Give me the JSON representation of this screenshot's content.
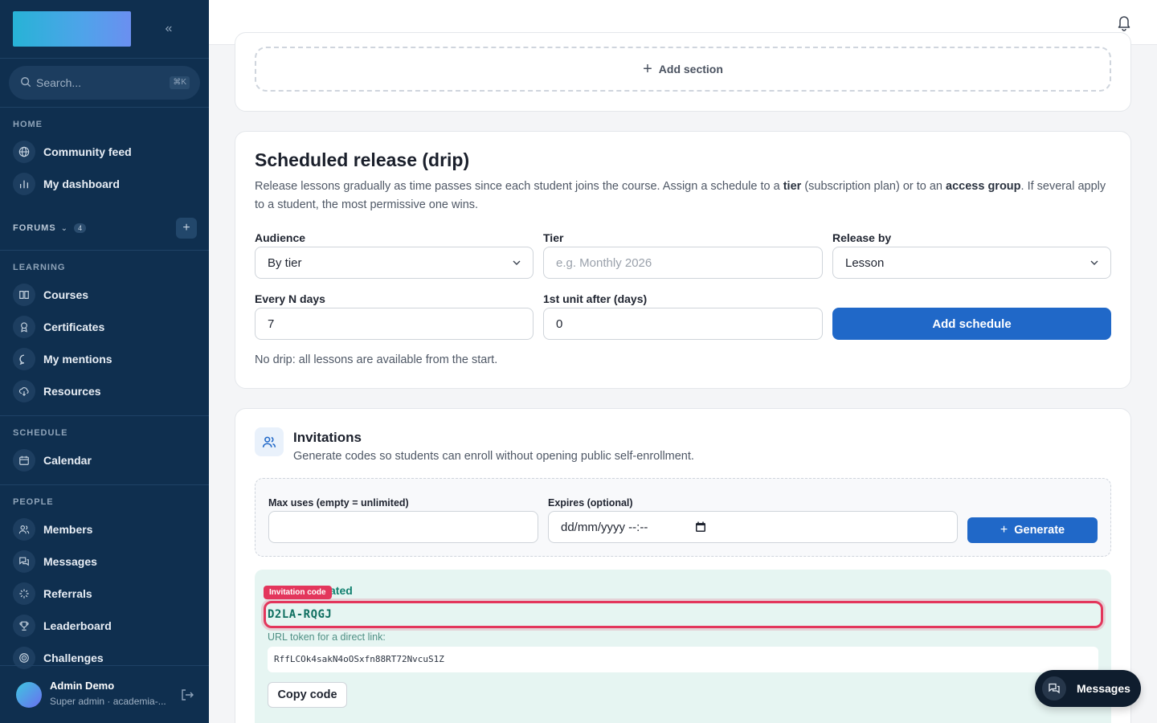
{
  "sidebar": {
    "collapse_icon": "double-chevron-left-icon",
    "search": {
      "placeholder": "Search...",
      "shortcut": "⌘K"
    },
    "sections": {
      "home": "HOME",
      "forums": "FORUMS",
      "forums_count": "4",
      "learning": "LEARNING",
      "schedule": "SCHEDULE",
      "people": "PEOPLE"
    },
    "items": {
      "community_feed": "Community feed",
      "my_dashboard": "My dashboard",
      "courses": "Courses",
      "certificates": "Certificates",
      "my_mentions": "My mentions",
      "resources": "Resources",
      "calendar": "Calendar",
      "members": "Members",
      "messages": "Messages",
      "referrals": "Referrals",
      "leaderboard": "Leaderboard",
      "challenges": "Challenges"
    },
    "user": {
      "name": "Admin Demo",
      "role": "Super admin · academia-..."
    }
  },
  "main": {
    "add_section": "Add section",
    "drip": {
      "title": "Scheduled release (drip)",
      "desc_1": "Release lessons gradually as time passes since each student joins the course. Assign a schedule to a ",
      "desc_tier": "tier",
      "desc_2": " (subscription plan) or to an ",
      "desc_group": "access group",
      "desc_3": ". If several apply to a student, the most permissive one wins.",
      "audience_label": "Audience",
      "audience_value": "By tier",
      "tier_label": "Tier",
      "tier_placeholder": "e.g. Monthly 2026",
      "release_label": "Release by",
      "release_value": "Lesson",
      "every_label": "Every N days",
      "every_value": "7",
      "first_label": "1st unit after (days)",
      "first_value": "0",
      "add_button": "Add schedule",
      "status": "No drip: all lessons are available from the start."
    },
    "invitations": {
      "title": "Invitations",
      "desc": "Generate codes so students can enroll without opening public self-enrollment.",
      "max_label": "Max uses (empty = unlimited)",
      "max_value": "",
      "expires_label": "Expires (optional)",
      "expires_value": "dd/mm/yyyy --:--",
      "generate_button": "Generate",
      "generated_label": "Code generated",
      "badge": "Invitation code",
      "code": "D2LA-RQGJ",
      "url_label": "URL token for a direct link:",
      "url_token": "RffLCOk4sakN4oOSxfn88RT72NvcuS1Z",
      "copy_button": "Copy code"
    }
  },
  "chat": {
    "label": "Messages"
  },
  "colors": {
    "sidebar": "#0f2f4f",
    "primary": "#2068c8",
    "highlight": "#e3365c",
    "code": "#0f6f60"
  }
}
